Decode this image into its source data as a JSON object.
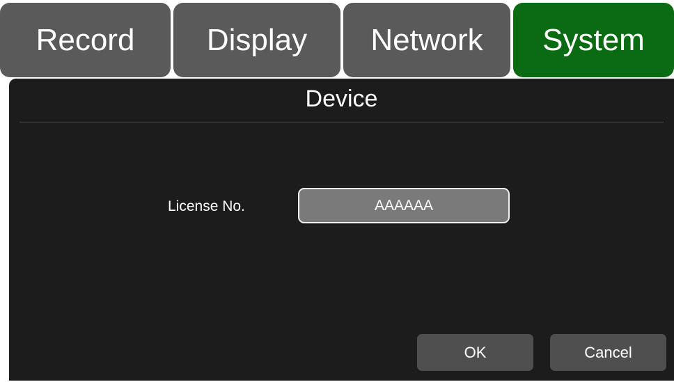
{
  "tabs": [
    {
      "label": "Record",
      "active": false
    },
    {
      "label": "Display",
      "active": false
    },
    {
      "label": "Network",
      "active": false
    },
    {
      "label": "System",
      "active": true
    }
  ],
  "panel": {
    "title": "Device",
    "license": {
      "label": "License No.",
      "value": "AAAAAA"
    },
    "buttons": {
      "ok": "OK",
      "cancel": "Cancel"
    }
  },
  "colors": {
    "tab_inactive": "#5a5a5a",
    "tab_active": "#0b6b12",
    "panel_bg": "#1c1c1c",
    "field_bg": "#7a7a7a",
    "button_bg": "#4f4f4f"
  }
}
